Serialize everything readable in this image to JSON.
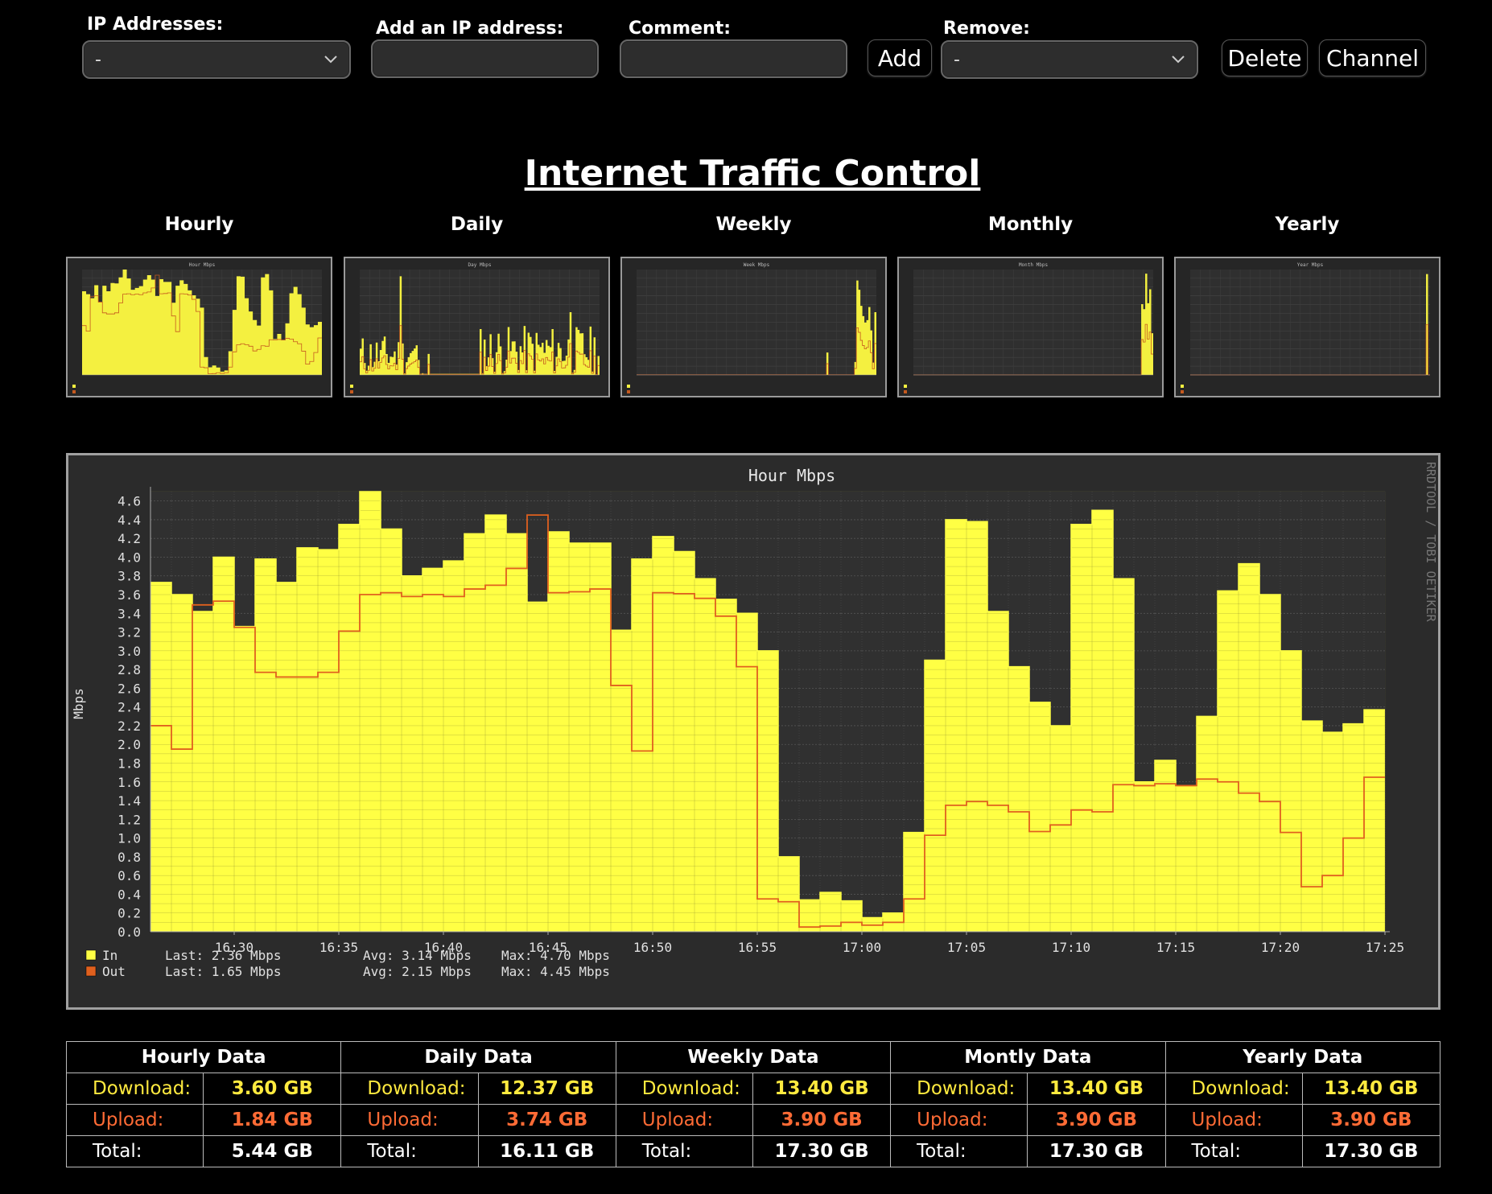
{
  "controls": {
    "ip_label": "IP Addresses:",
    "ip_value": "-",
    "add_ip_label": "Add an IP address:",
    "comment_label": "Comment:",
    "add_button": "Add",
    "remove_label": "Remove:",
    "remove_value": "-",
    "delete_button": "Delete",
    "channel_button": "Channel"
  },
  "page_title": "Internet Traffic Control",
  "thumbnails": [
    {
      "label": "Hourly",
      "title": "Hour Mbps"
    },
    {
      "label": "Daily",
      "title": "Day Mbps"
    },
    {
      "label": "Weekly",
      "title": "Week Mbps"
    },
    {
      "label": "Monthly",
      "title": "Month Mbps"
    },
    {
      "label": "Yearly",
      "title": "Year Mbps"
    }
  ],
  "chart_data": {
    "type": "area",
    "title": "Hour Mbps",
    "ylabel": "Mbps",
    "watermark": "RRDTOOL / TOBI OETIKER",
    "ylim": [
      0,
      4.7
    ],
    "yticks": [
      "0.0",
      "0.2",
      "0.4",
      "0.6",
      "0.8",
      "1.0",
      "1.2",
      "1.4",
      "1.6",
      "1.8",
      "2.0",
      "2.2",
      "2.4",
      "2.6",
      "2.8",
      "3.0",
      "3.2",
      "3.4",
      "3.6",
      "3.8",
      "4.0",
      "4.2",
      "4.4",
      "4.6"
    ],
    "xticks": [
      "16:30",
      "16:35",
      "16:40",
      "16:45",
      "16:50",
      "16:55",
      "17:00",
      "17:05",
      "17:10",
      "17:15",
      "17:20",
      "17:25"
    ],
    "x_start": "16:26",
    "x_end": "17:25",
    "step_minutes": 1,
    "series": [
      {
        "name": "In",
        "color": "#ffff44",
        "values": [
          3.73,
          3.6,
          3.42,
          4.0,
          3.26,
          3.98,
          3.73,
          4.1,
          4.08,
          4.35,
          4.7,
          4.3,
          3.8,
          3.88,
          3.96,
          4.25,
          4.45,
          4.25,
          3.52,
          4.27,
          4.15,
          4.15,
          3.22,
          3.98,
          4.22,
          4.06,
          3.77,
          3.55,
          3.4,
          3.0,
          0.8,
          0.34,
          0.42,
          0.33,
          0.15,
          0.2,
          1.06,
          2.9,
          4.4,
          4.38,
          3.42,
          2.83,
          2.45,
          2.2,
          4.35,
          4.5,
          3.77,
          1.6,
          1.83,
          1.55,
          2.3,
          3.64,
          3.93,
          3.6,
          3.0,
          2.25,
          2.13,
          2.22,
          2.37
        ]
      },
      {
        "name": "Out",
        "color": "#e0601e",
        "values": [
          2.2,
          1.95,
          3.49,
          3.53,
          3.25,
          2.77,
          2.72,
          2.72,
          2.77,
          3.21,
          3.6,
          3.62,
          3.58,
          3.6,
          3.58,
          3.66,
          3.7,
          3.88,
          4.45,
          3.62,
          3.63,
          3.66,
          2.63,
          1.93,
          3.62,
          3.61,
          3.56,
          3.37,
          2.83,
          0.35,
          0.32,
          0.05,
          0.06,
          0.1,
          0.07,
          0.1,
          0.35,
          1.03,
          1.35,
          1.39,
          1.35,
          1.28,
          1.07,
          1.14,
          1.3,
          1.28,
          1.57,
          1.56,
          1.58,
          1.56,
          1.63,
          1.6,
          1.48,
          1.39,
          1.06,
          0.48,
          0.6,
          1.0,
          1.65
        ]
      }
    ],
    "legend": [
      {
        "name": "In",
        "last": "Last: 2.36 Mbps",
        "avg": "Avg: 3.14 Mbps",
        "max": "Max: 4.70 Mbps"
      },
      {
        "name": "Out",
        "last": "Last: 1.65 Mbps",
        "avg": "Avg: 2.15 Mbps",
        "max": "Max: 4.45 Mbps"
      }
    ]
  },
  "stats": {
    "headers": [
      "Hourly Data",
      "Daily Data",
      "Weekly Data",
      "Montly Data",
      "Yearly Data"
    ],
    "download_label": "Download:",
    "upload_label": "Upload:",
    "total_label": "Total:",
    "download": [
      "3.60 GB",
      "12.37 GB",
      "13.40 GB",
      "13.40 GB",
      "13.40 GB"
    ],
    "upload": [
      "1.84 GB",
      "3.74 GB",
      "3.90 GB",
      "3.90 GB",
      "3.90 GB"
    ],
    "total": [
      "5.44 GB",
      "16.11 GB",
      "17.30 GB",
      "17.30 GB",
      "17.30 GB"
    ],
    "colors": {
      "download": "#ffea3f",
      "upload": "#ff6b35",
      "total": "#ffffff"
    }
  }
}
